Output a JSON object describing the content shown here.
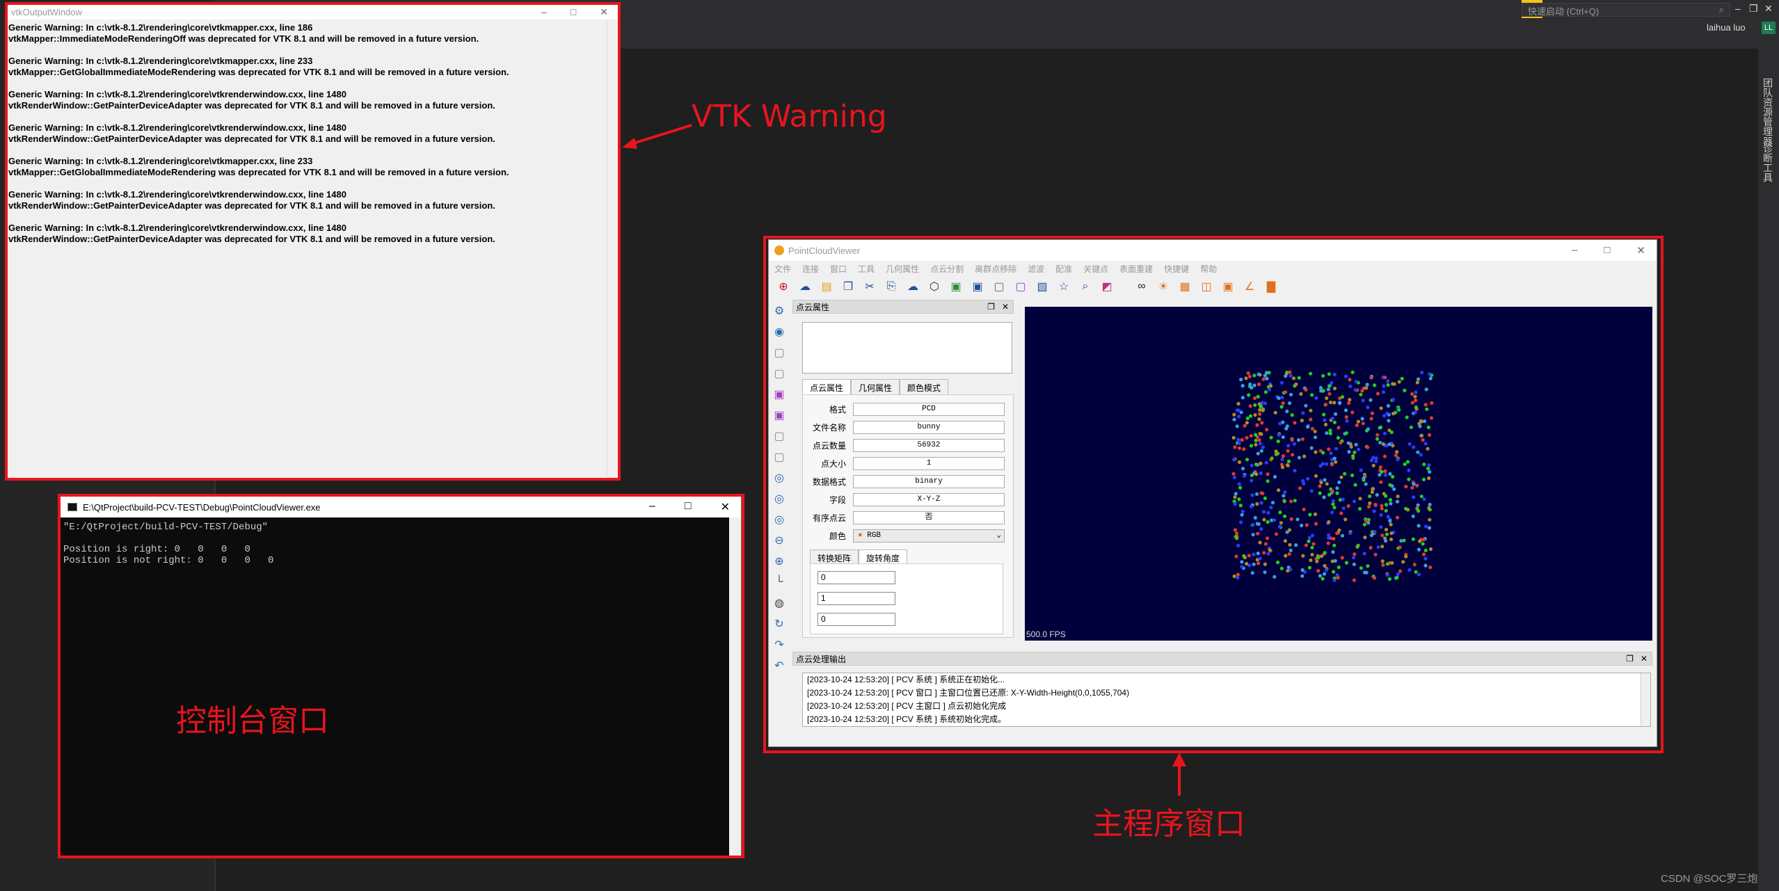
{
  "ide": {
    "quick_launch_placeholder": "快速启动 (Ctrl+Q)",
    "user_name": "laihua luo",
    "user_initials": "LL",
    "side_tabs": [
      "团队资源管理器",
      "诊断工具"
    ]
  },
  "vtk_window": {
    "title": "vtkOutputWindow",
    "log": "Generic Warning: In c:\\vtk-8.1.2\\rendering\\core\\vtkmapper.cxx, line 186\nvtkMapper::ImmediateModeRenderingOff was deprecated for VTK 8.1 and will be removed in a future version.\n\nGeneric Warning: In c:\\vtk-8.1.2\\rendering\\core\\vtkmapper.cxx, line 233\nvtkMapper::GetGlobalImmediateModeRendering was deprecated for VTK 8.1 and will be removed in a future version.\n\nGeneric Warning: In c:\\vtk-8.1.2\\rendering\\core\\vtkrenderwindow.cxx, line 1480\nvtkRenderWindow::GetPainterDeviceAdapter was deprecated for VTK 8.1 and will be removed in a future version.\n\nGeneric Warning: In c:\\vtk-8.1.2\\rendering\\core\\vtkrenderwindow.cxx, line 1480\nvtkRenderWindow::GetPainterDeviceAdapter was deprecated for VTK 8.1 and will be removed in a future version.\n\nGeneric Warning: In c:\\vtk-8.1.2\\rendering\\core\\vtkmapper.cxx, line 233\nvtkMapper::GetGlobalImmediateModeRendering was deprecated for VTK 8.1 and will be removed in a future version.\n\nGeneric Warning: In c:\\vtk-8.1.2\\rendering\\core\\vtkrenderwindow.cxx, line 1480\nvtkRenderWindow::GetPainterDeviceAdapter was deprecated for VTK 8.1 and will be removed in a future version.\n\nGeneric Warning: In c:\\vtk-8.1.2\\rendering\\core\\vtkrenderwindow.cxx, line 1480\nvtkRenderWindow::GetPainterDeviceAdapter was deprecated for VTK 8.1 and will be removed in a future version."
  },
  "console_window": {
    "title": "E:\\QtProject\\build-PCV-TEST\\Debug\\PointCloudViewer.exe",
    "log": "\"E:/QtProject/build-PCV-TEST/Debug\"\n\nPosition is right: 0   0   0   0\nPosition is not right: 0   0   0   0"
  },
  "annotations": {
    "vtk": "VTK Warning",
    "console": "控制台窗口",
    "main": "主程序窗口"
  },
  "pcv": {
    "title": "PointCloudViewer",
    "menu": [
      "文件",
      "连接",
      "窗口",
      "工具",
      "几何属性",
      "点云分割",
      "离群点移除",
      "滤波",
      "配准",
      "关键点",
      "表面重建",
      "快捷键",
      "帮助"
    ],
    "dock_title": "点云属性",
    "tabs": [
      "点云属性",
      "几何属性",
      "颜色模式"
    ],
    "props": [
      {
        "label": "格式",
        "value": "PCD"
      },
      {
        "label": "文件名称",
        "value": "bunny"
      },
      {
        "label": "点云数量",
        "value": "56932"
      },
      {
        "label": "点大小",
        "value": "1"
      },
      {
        "label": "数据格式",
        "value": "binary"
      },
      {
        "label": "字段",
        "value": "X-Y-Z"
      },
      {
        "label": "有序点云",
        "value": "否"
      }
    ],
    "color_label": "颜色",
    "color_value": "RGB",
    "subtabs": [
      "转换矩阵",
      "旋转角度"
    ],
    "rotation": [
      "0",
      "1",
      "0"
    ],
    "fps": "500.0 FPS",
    "output_title": "点云处理输出",
    "output_lines": [
      "[2023-10-24 12:53:20] [ PCV 系统 ] 系统正在初始化...",
      "[2023-10-24 12:53:20] [ PCV 窗口 ] 主窗口位置已还原: X-Y-Width-Height(0,0,1055,704)",
      "[2023-10-24 12:53:20] [ PCV 主窗口 ] 点云初始化完成",
      "[2023-10-24 12:53:20] [ PCV 系统 ] 系统初始化完成。"
    ]
  },
  "colors": {
    "accent": "#e8141e",
    "viewer_bg": "#00003c"
  },
  "watermark": "CSDN @SOC罗三炮"
}
